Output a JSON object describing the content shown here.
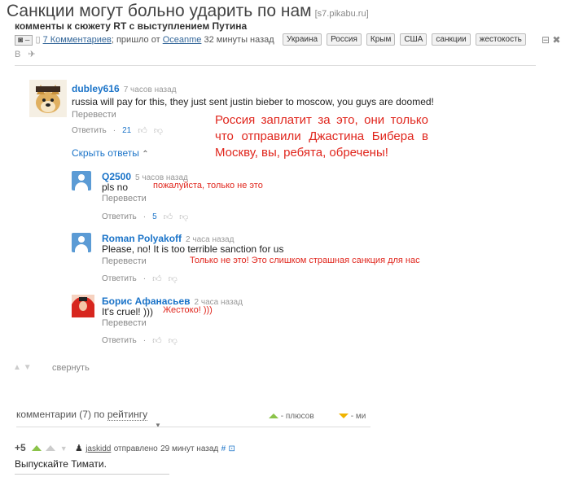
{
  "header": {
    "title": "Санкции могут больно ударить по нам",
    "source": "[s7.pikabu.ru]",
    "subtitle": "комменты к сюжету RT с выступлением Путина",
    "comments_link": "7 Комментариев",
    "posted_from": "; пришло от",
    "author_link": "Oceanme",
    "posted_time": "32 минуты назад",
    "rating_box": "–",
    "tags": [
      "Украина",
      "Россия",
      "Крым",
      "США",
      "санкции",
      "жестокость"
    ],
    "share": "B ✈"
  },
  "comments": [
    {
      "author": "dubley616",
      "time": "7 часов назад",
      "text": "russia will pay for this, they just sent justin bieber to moscow, you guys are doomed!",
      "translate": "Перевести",
      "reply": "Ответить",
      "likes": "21",
      "annotation": "Россия заплатит за это, они только что отправили Джастина Бибера в Москву, вы, ребята, обречены!"
    }
  ],
  "hide_replies": "Скрыть ответы",
  "replies": [
    {
      "author": "Q2500",
      "time": "5 часов назад",
      "text": "pls no",
      "translate": "Перевести",
      "reply": "Ответить",
      "likes": "5",
      "annotation": "пожалуйста, только не это"
    },
    {
      "author": "Roman Polyakoff",
      "time": "2 часа назад",
      "text": "Please, no! It is too terrible sanction for us",
      "translate": "Перевести",
      "reply": "Ответить",
      "likes": "",
      "annotation": "Только не это! Это слишком страшная санкция для нас"
    },
    {
      "author": "Борис Афанасьев",
      "time": "2 часа назад",
      "text": "It's cruel! )))",
      "translate": "Перевести",
      "reply": "Ответить",
      "likes": "",
      "annotation": "Жестоко! )))"
    }
  ],
  "collapse": "свернуть",
  "footer": {
    "sort_label": "комментарии (7) по",
    "sort_value": "рейтингу",
    "pluses": "- плюсов",
    "minuses": "- ми",
    "comment": {
      "score": "+5",
      "author": "jaskidd",
      "posted": "отправлено",
      "time": "29 минут назад",
      "hash": "#",
      "text": "Выпускайте Тимати."
    }
  }
}
